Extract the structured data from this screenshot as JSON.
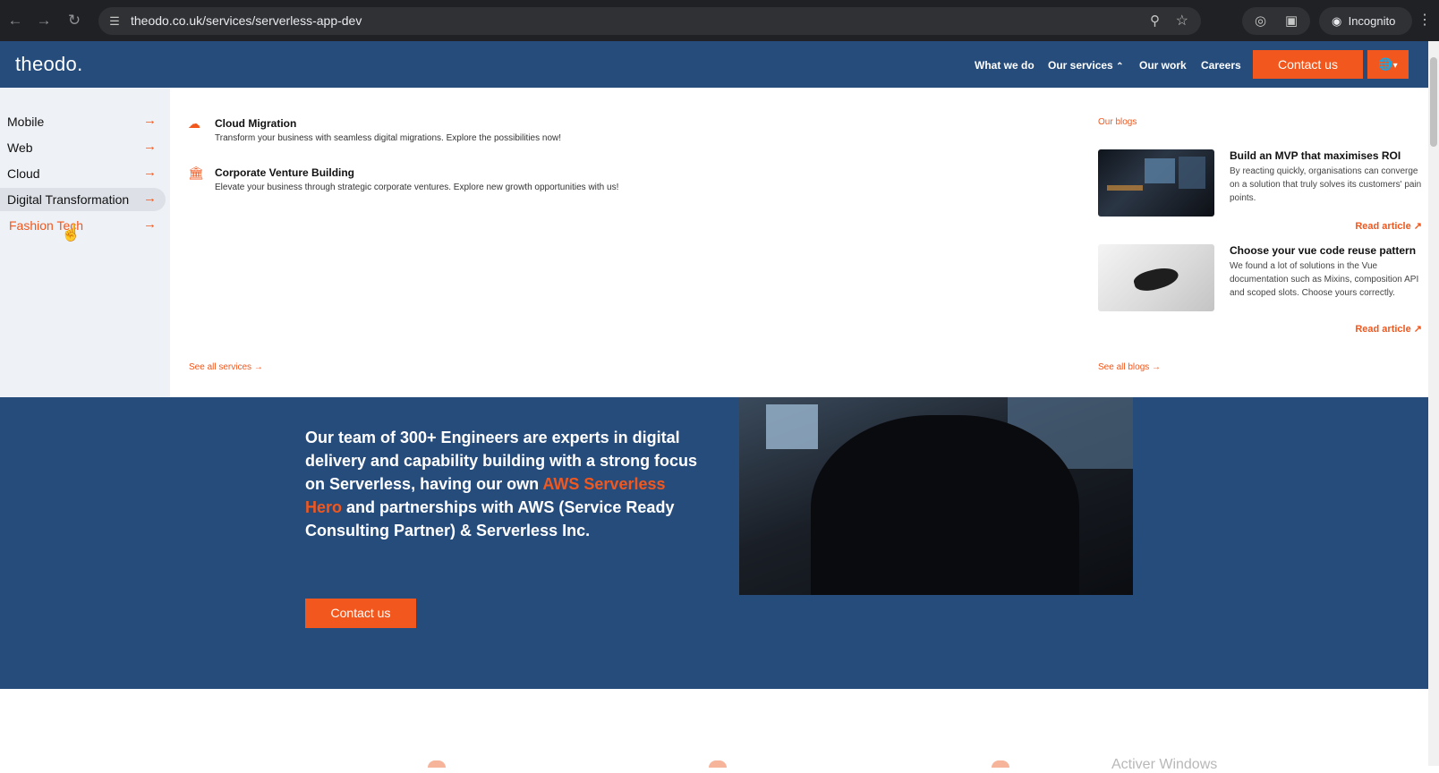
{
  "browser": {
    "url": "theodo.co.uk/services/serverless-app-dev",
    "profile": "Incognito"
  },
  "header": {
    "logo": "theodo.",
    "nav": [
      "What we do",
      "Our services",
      "Our work",
      "Careers"
    ],
    "contact": "Contact us"
  },
  "menu": {
    "categories": [
      "Mobile",
      "Web",
      "Cloud",
      "Digital Transformation",
      "Fashion Tech"
    ],
    "active_category": "Digital Transformation",
    "hovered_category": "Fashion Tech",
    "services": [
      {
        "title": "Cloud Migration",
        "desc": "Transform your business with seamless digital migrations. Explore the possibilities now!"
      },
      {
        "title": "Corporate Venture Building",
        "desc": "Elevate your business through strategic corporate ventures. Explore new growth opportunities with us!"
      }
    ],
    "see_all_services": "See all services",
    "blogs_heading": "Our blogs",
    "blogs": [
      {
        "title": "Build an MVP that maximises ROI",
        "desc": "By reacting quickly, organisations can converge on a solution that truly solves its customers' pain points.",
        "link": "Read article"
      },
      {
        "title": "Choose your vue code reuse pattern",
        "desc": "We found a lot of solutions in the Vue documentation such as Mixins, composition API and scoped slots. Choose yours correctly.",
        "link": "Read article"
      }
    ],
    "see_all_blogs": "See all blogs"
  },
  "hero": {
    "text_before": "Our team of 300+ Engineers are experts in digital delivery and capability building with a strong focus on Serverless, having our own ",
    "highlight": "AWS Serverless Hero",
    "text_after": " and partnerships with AWS (Service Ready Consulting Partner) & Serverless Inc.",
    "button": "Contact us"
  },
  "watermark": "Activer Windows",
  "colors": {
    "brand_blue": "#264c7c",
    "accent": "#f2571d"
  }
}
